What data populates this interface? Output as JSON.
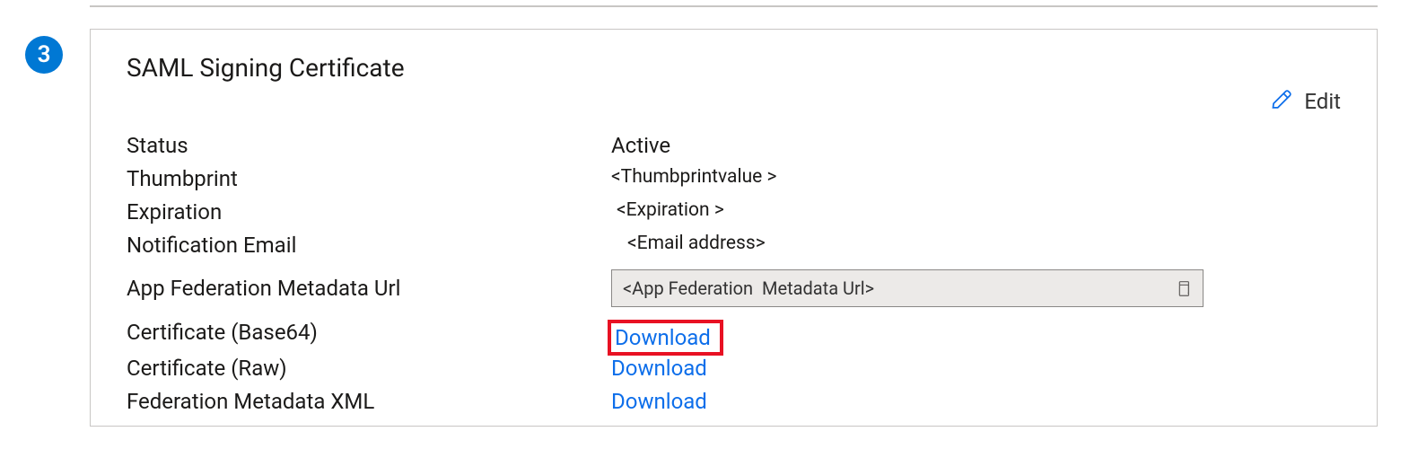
{
  "step": {
    "number": "3"
  },
  "card": {
    "title": "SAML Signing Certificate",
    "edit_label": "Edit",
    "fields": {
      "status_label": "Status",
      "status_value": "Active",
      "thumbprint_label": "Thumbprint",
      "thumbprint_value": "<Thumbprintvalue >",
      "expiration_label": "Expiration",
      "expiration_value": "<Expiration >",
      "notification_email_label": "Notification Email",
      "notification_email_value": "<Email address>",
      "metadata_url_label": "App Federation Metadata Url",
      "metadata_url_value": "<App Federation  Metadata Url>",
      "cert_base64_label": "Certificate (Base64)",
      "cert_base64_link": "Download",
      "cert_raw_label": "Certificate (Raw)",
      "cert_raw_link": "Download",
      "metadata_xml_label": "Federation Metadata XML",
      "metadata_xml_link": "Download"
    }
  },
  "colors": {
    "accent": "#0078d4",
    "link": "#0d6eea",
    "highlight": "#e81123"
  }
}
